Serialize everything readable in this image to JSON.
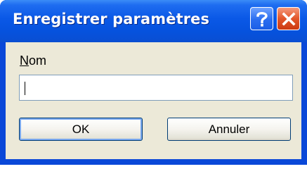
{
  "window": {
    "title": "Enregistrer paramètres",
    "help_icon": "question-mark",
    "close_icon": "x-close"
  },
  "form": {
    "name_label_accel": "N",
    "name_label_rest": "om",
    "name_value": ""
  },
  "buttons": {
    "ok_label": "OK",
    "cancel_label": "Annuler"
  },
  "colors": {
    "titlebar": "#0652dd",
    "client_bg": "#ece9d8",
    "close_button": "#e2562a"
  }
}
